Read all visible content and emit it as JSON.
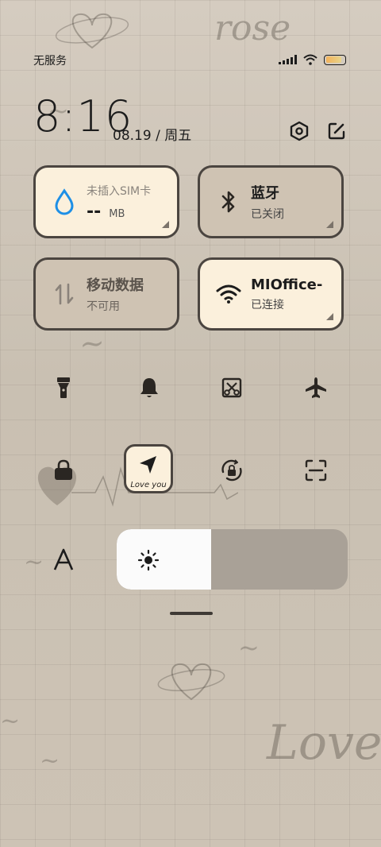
{
  "status_bar": {
    "carrier": "无服务",
    "signal_bars": 4,
    "battery_level": 0.85
  },
  "header": {
    "time": "8:16",
    "date": "08.19 / 周五",
    "icons": [
      "settings-icon",
      "edit-icon"
    ]
  },
  "tiles": [
    {
      "id": "data-usage",
      "title": "未插入SIM卡",
      "value": "--",
      "unit": "MB",
      "state": "light",
      "icon": "water-drop-icon"
    },
    {
      "id": "bluetooth",
      "title": "蓝牙",
      "subtitle": "已关闭",
      "state": "dim",
      "icon": "bluetooth-icon"
    },
    {
      "id": "mobile-data",
      "title": "移动数据",
      "subtitle": "不可用",
      "state": "dim",
      "icon": "data-arrows-icon"
    },
    {
      "id": "wifi",
      "title": "MIOffice-",
      "subtitle": "已连接",
      "state": "light",
      "icon": "wifi-icon"
    }
  ],
  "toggles_row1": [
    "flashlight-icon",
    "bell-icon",
    "screenshot-icon",
    "airplane-icon"
  ],
  "toggles_row2": [
    "lock-icon",
    "location-icon",
    "rotation-lock-icon",
    "scan-icon"
  ],
  "location_label": "Love you",
  "brightness": {
    "label_icon": "font-size-icon",
    "level": 0.41
  },
  "colors": {
    "tile_light": "#fbf0dc",
    "tile_dim": "#cfc3b3",
    "tile_border": "#4b4540",
    "background": "#cfc6b8"
  }
}
